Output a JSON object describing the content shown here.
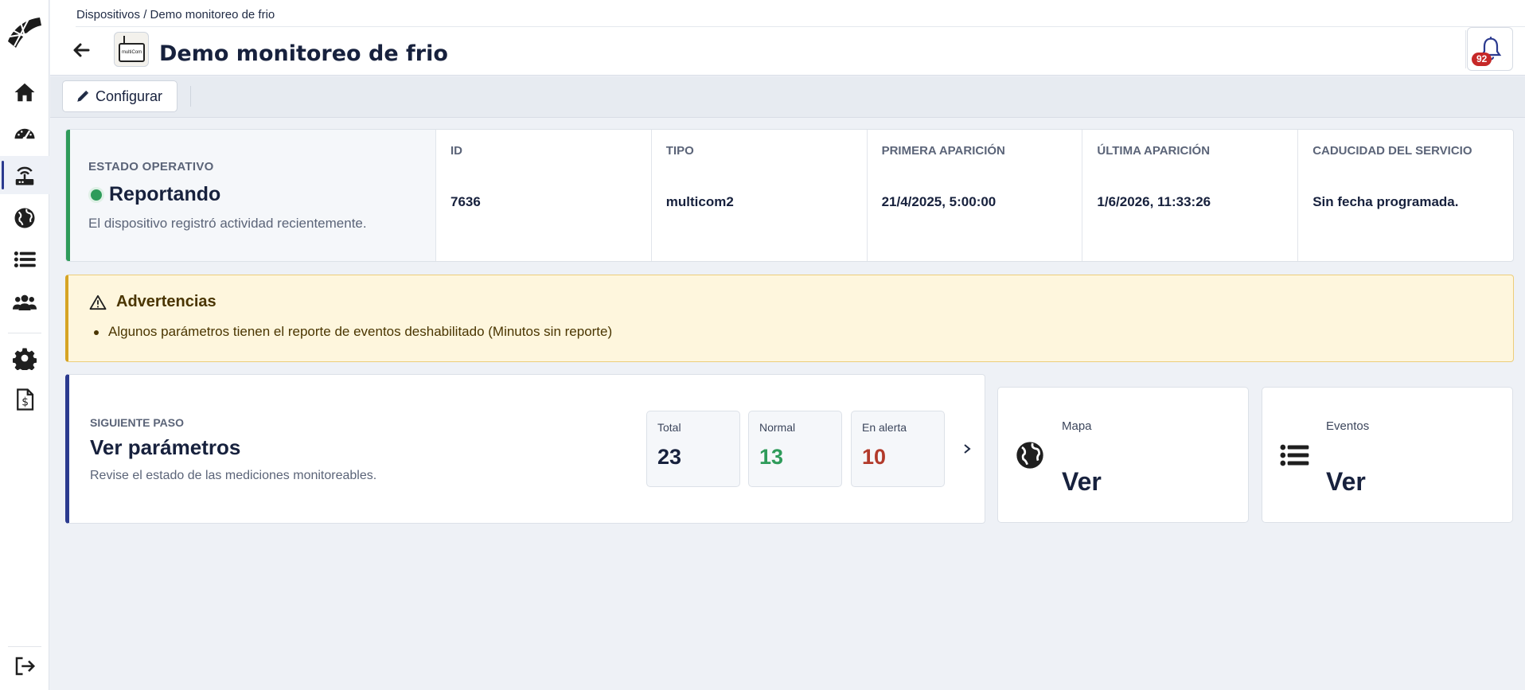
{
  "colors": {
    "primary": "#2b3a8f",
    "status_ok": "#2e9b5a",
    "alert": "#b23a2b",
    "warning_bg": "#fef6dd",
    "badge": "#c62828"
  },
  "sidebar": {
    "items": [
      {
        "name": "home",
        "icon": "home-icon"
      },
      {
        "name": "dashboard",
        "icon": "gauge-icon"
      },
      {
        "name": "devices",
        "icon": "router-icon",
        "active": true
      },
      {
        "name": "map",
        "icon": "globe-icon"
      },
      {
        "name": "list",
        "icon": "list-icon"
      },
      {
        "name": "users",
        "icon": "users-icon"
      },
      {
        "name": "settings",
        "icon": "gear-icon"
      },
      {
        "name": "billing",
        "icon": "invoice-dollar-icon"
      },
      {
        "name": "logout",
        "icon": "logout-icon"
      }
    ]
  },
  "header": {
    "breadcrumb": "Dispositivos / Demo monitoreo de frio",
    "title": "Demo monitoreo de frio",
    "device_thumb_text": "multiCom",
    "notifications_count": "92"
  },
  "toolbar": {
    "configure_label": "Configurar"
  },
  "status": {
    "label": "ESTADO OPERATIVO",
    "value": "Reportando",
    "description": "El dispositivo registró actividad recientemente.",
    "columns": [
      {
        "label": "ID",
        "value": "7636"
      },
      {
        "label": "TIPO",
        "value": "multicom2"
      },
      {
        "label": "PRIMERA APARICIÓN",
        "value": "21/4/2025, 5:00:00"
      },
      {
        "label": "ÚLTIMA APARICIÓN",
        "value": "1/6/2026, 11:33:26"
      },
      {
        "label": "CADUCIDAD DEL SERVICIO",
        "value": "Sin fecha programada."
      }
    ]
  },
  "warnings": {
    "title": "Advertencias",
    "items": [
      "Algunos parámetros tienen el reporte de eventos deshabilitado (Minutos sin reporte)"
    ]
  },
  "next_step": {
    "label": "SIGUIENTE PASO",
    "title": "Ver parámetros",
    "description": "Revise el estado de las mediciones monitoreables.",
    "stats": [
      {
        "label": "Total",
        "value": "23"
      },
      {
        "label": "Normal",
        "value": "13"
      },
      {
        "label": "En alerta",
        "value": "10"
      }
    ]
  },
  "quick_links": [
    {
      "label": "Mapa",
      "value": "Ver",
      "icon": "globe-icon"
    },
    {
      "label": "Eventos",
      "value": "Ver",
      "icon": "list-icon"
    }
  ]
}
